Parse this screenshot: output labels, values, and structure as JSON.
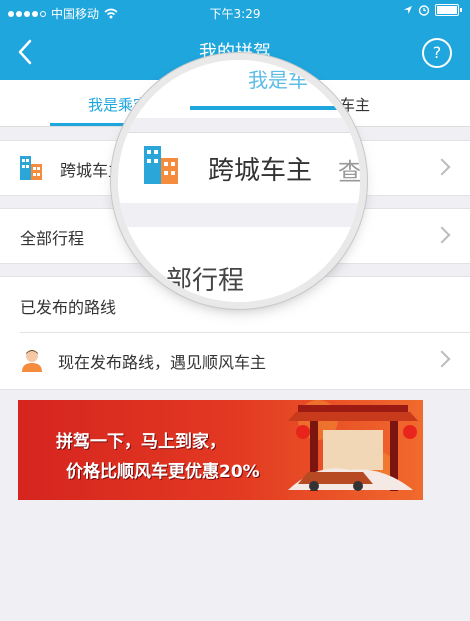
{
  "status_bar": {
    "carrier": "中国移动",
    "time": "下午3:29"
  },
  "nav": {
    "title": "我的拼驾",
    "help_symbol": "?"
  },
  "tabs": {
    "passenger": "我是乘客",
    "driver": "我是车主",
    "magnified_text": "我是车"
  },
  "rows": {
    "intercity_label": "跨城车主",
    "all_trips_label": "全部行程",
    "published_routes_label": "已发布的路线",
    "publish_route_label": "现在发布路线，遇见顺风车主"
  },
  "magnifier": {
    "label": "跨城车主",
    "view_text": "查",
    "partial_text": "部行程"
  },
  "banner": {
    "line1": "拼驾一下，马上到家，",
    "line2": "价格比顺风车更优惠20%"
  },
  "colors": {
    "brand": "#1fa6dd"
  }
}
